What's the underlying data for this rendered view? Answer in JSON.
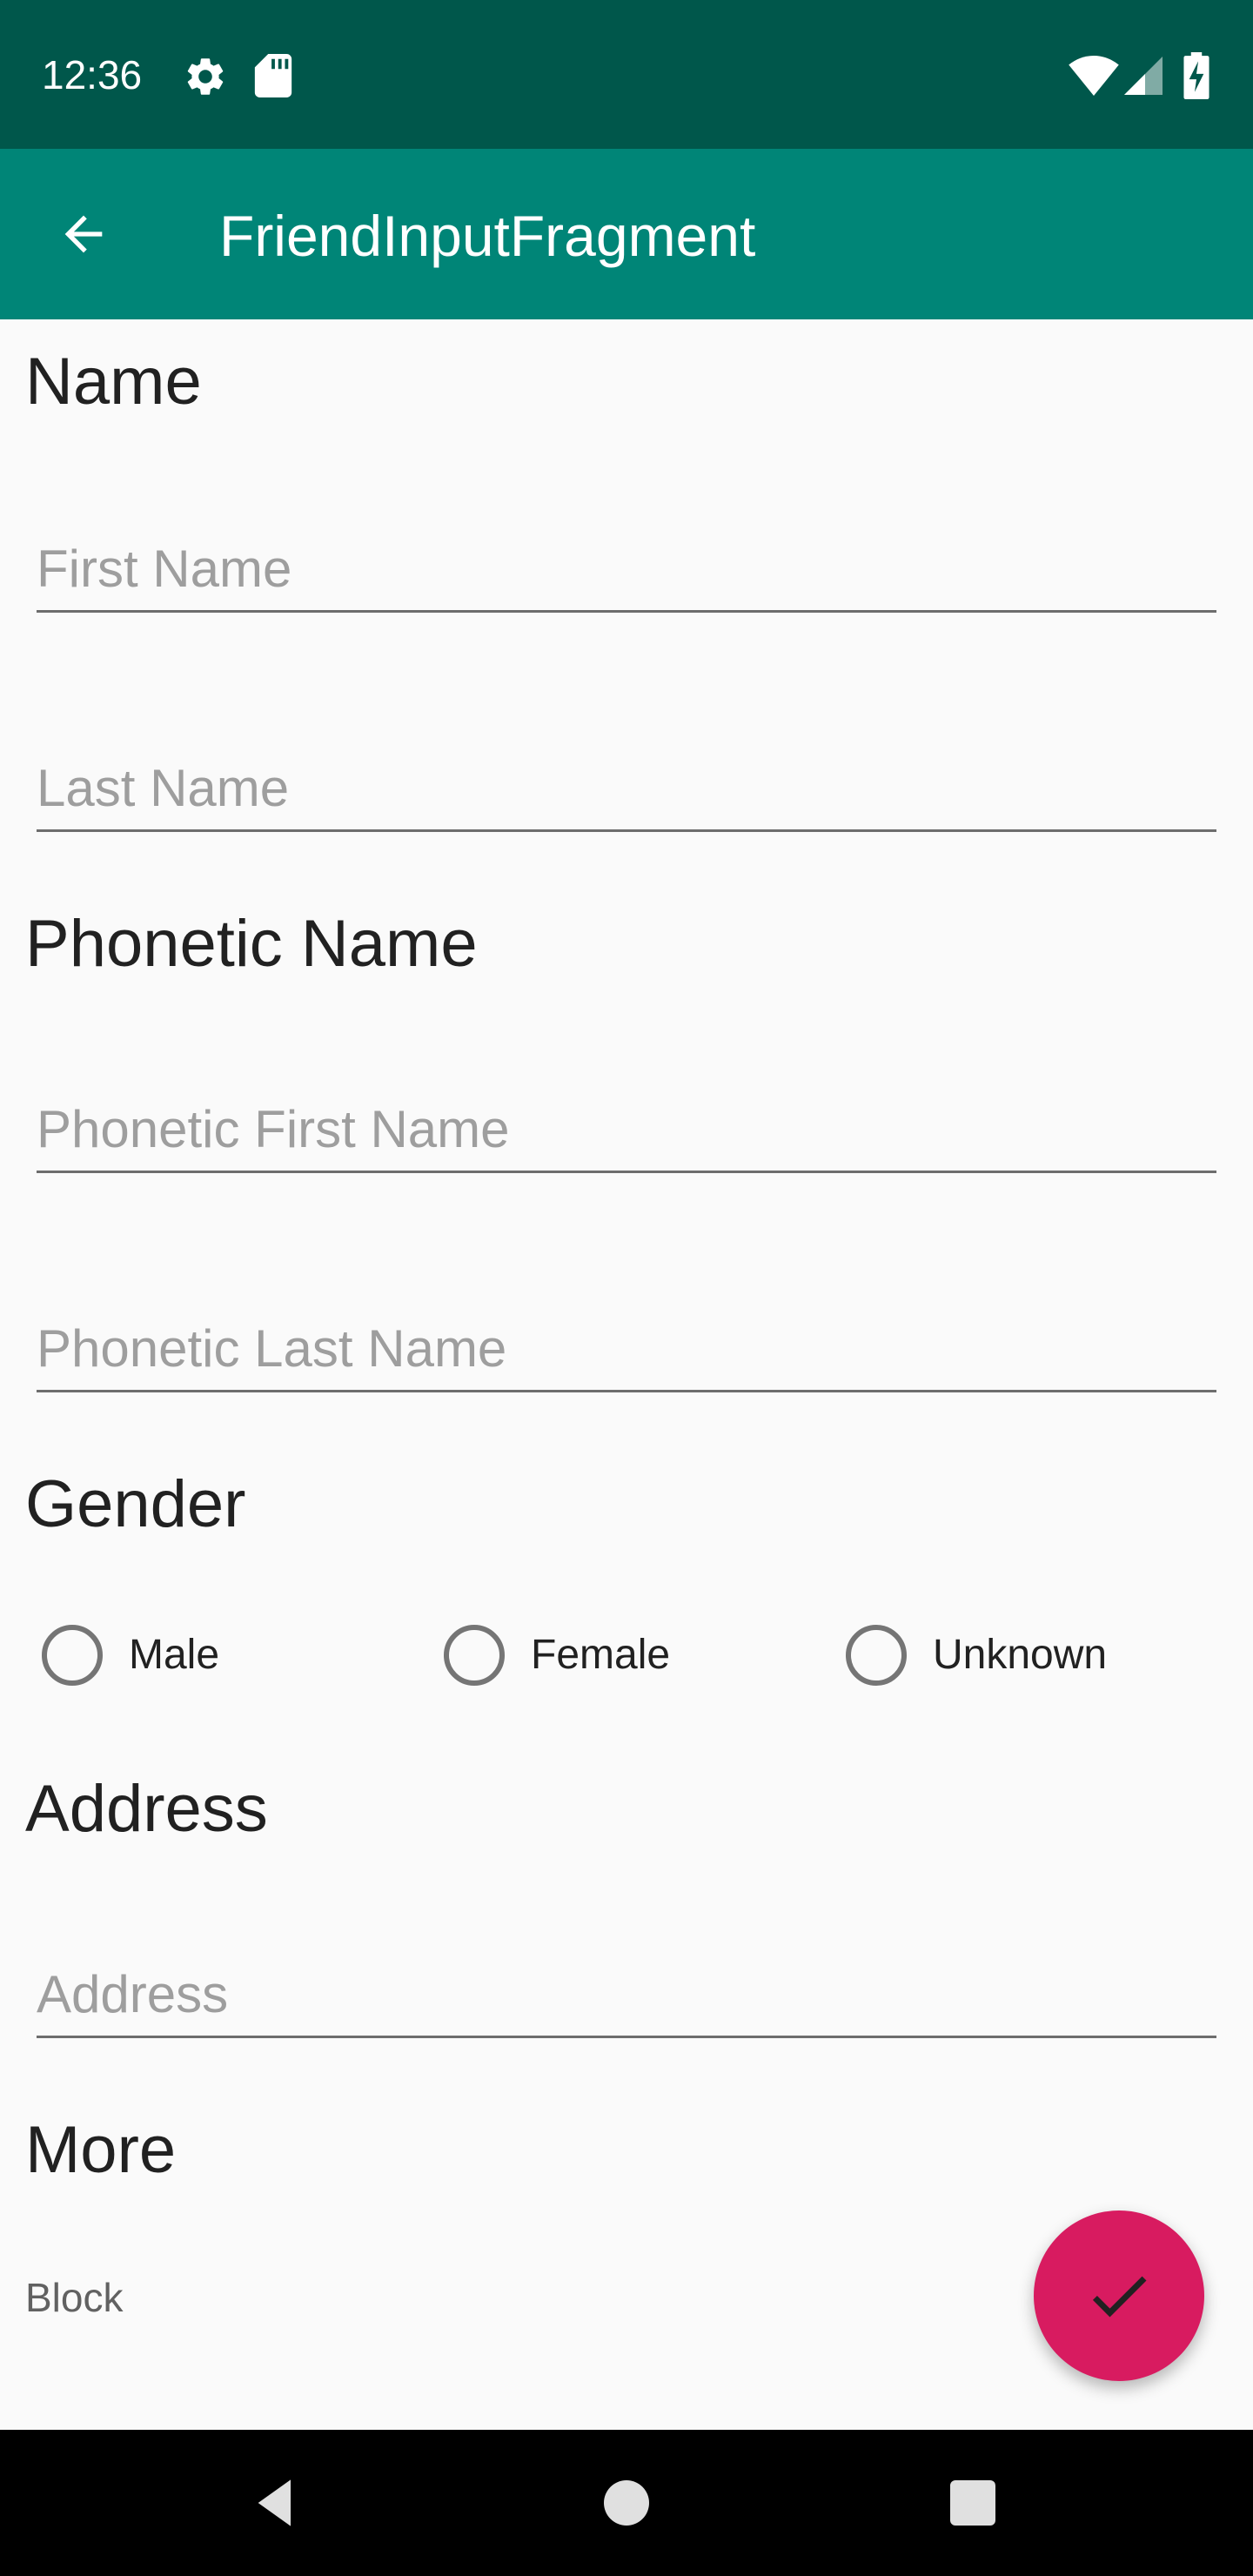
{
  "status_bar": {
    "time": "12:36",
    "icons": [
      "gear-icon",
      "sd-card-icon",
      "wifi-icon",
      "signal-icon",
      "battery-charging-icon"
    ]
  },
  "app_bar": {
    "title": "FriendInputFragment",
    "back_icon": "arrow-back-icon"
  },
  "form": {
    "name_section": {
      "title": "Name",
      "first_name_hint": "First Name",
      "last_name_hint": "Last Name"
    },
    "phonetic_section": {
      "title": "Phonetic Name",
      "first_name_hint": "Phonetic First Name",
      "last_name_hint": "Phonetic Last Name"
    },
    "gender_section": {
      "title": "Gender",
      "options": [
        "Male",
        "Female",
        "Unknown"
      ],
      "selected": null
    },
    "address_section": {
      "title": "Address",
      "address_hint": "Address"
    },
    "more_section": {
      "title": "More",
      "block_label": "Block"
    }
  },
  "fab": {
    "icon": "check-icon",
    "color": "#d81b60"
  },
  "colors": {
    "status_bar": "#00574b",
    "app_bar": "#008577",
    "accent": "#d81b60",
    "background": "#fafafa"
  },
  "nav_bar": {
    "icons": [
      "nav-back-icon",
      "nav-home-icon",
      "nav-recents-icon"
    ]
  }
}
